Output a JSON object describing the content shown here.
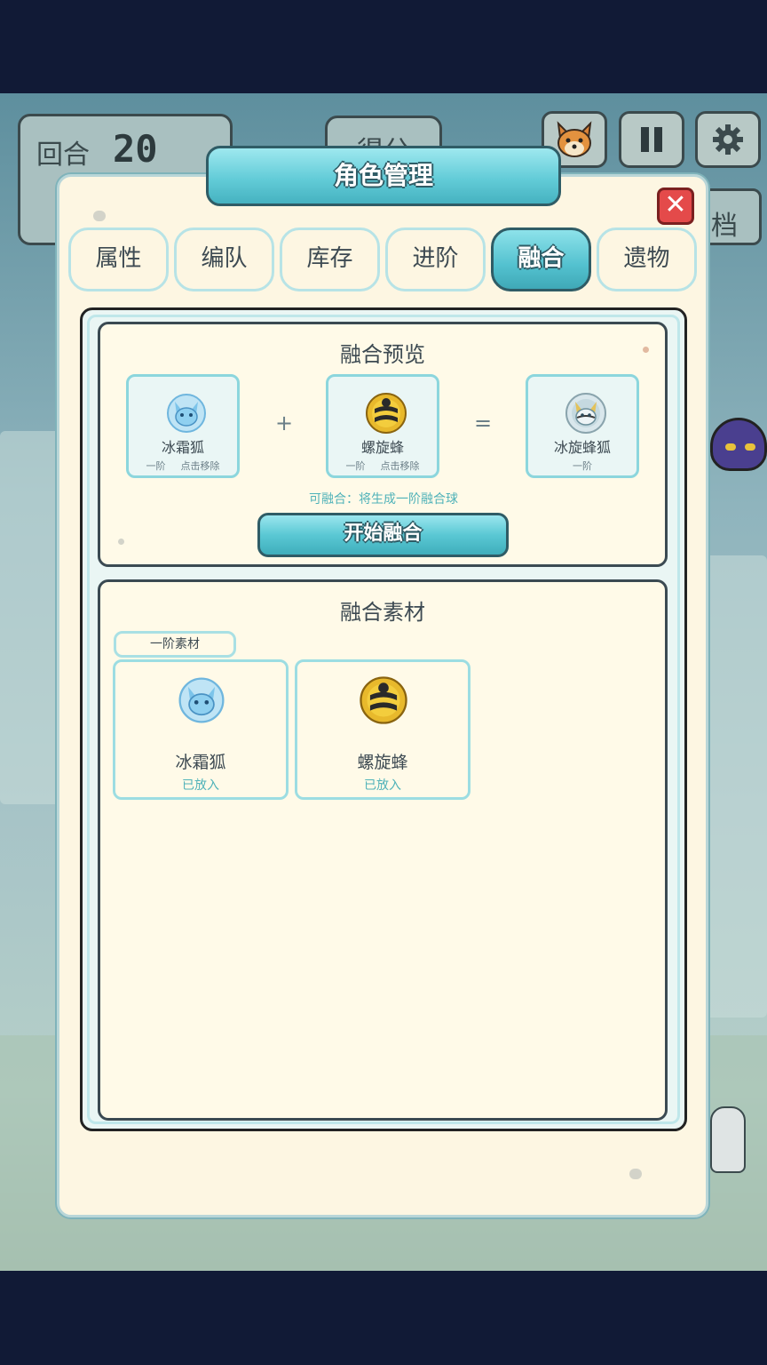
{
  "hud": {
    "round_label": "回合",
    "round_value": "20",
    "score_label": "得分",
    "save_label": "档",
    "pause_icon": "pause-icon",
    "settings_icon": "gear-icon",
    "pet_icon": "shiba-avatar-icon"
  },
  "modal": {
    "title": "角色管理",
    "close_label": "✕",
    "tabs": [
      {
        "label": "属性",
        "active": false
      },
      {
        "label": "编队",
        "active": false
      },
      {
        "label": "库存",
        "active": false
      },
      {
        "label": "进阶",
        "active": false
      },
      {
        "label": "融合",
        "active": true
      },
      {
        "label": "遗物",
        "active": false
      }
    ]
  },
  "fusion_preview": {
    "title": "融合预览",
    "plus": "+",
    "equals": "=",
    "slot1": {
      "name": "冰霜狐",
      "tier": "一阶",
      "action": "点击移除",
      "icon": "ice-fox-icon"
    },
    "slot2": {
      "name": "螺旋蜂",
      "tier": "一阶",
      "action": "点击移除",
      "icon": "spiral-bee-icon"
    },
    "result": {
      "name": "冰旋蜂狐",
      "tier": "一阶",
      "icon": "ice-spiral-bee-fox-icon"
    },
    "hint": "可融合：将生成一阶融合球",
    "start_button": "开始融合"
  },
  "materials": {
    "title": "融合素材",
    "tier_tag": "一阶素材",
    "items": [
      {
        "name": "冰霜狐",
        "status": "已放入",
        "icon": "ice-fox-icon"
      },
      {
        "name": "螺旋蜂",
        "status": "已放入",
        "icon": "spiral-bee-icon"
      }
    ]
  },
  "colors": {
    "accent": "#53c1cf",
    "panel_bg": "#fffae8",
    "close_red": "#e44a4a",
    "hint_teal": "#4fb2b9"
  }
}
